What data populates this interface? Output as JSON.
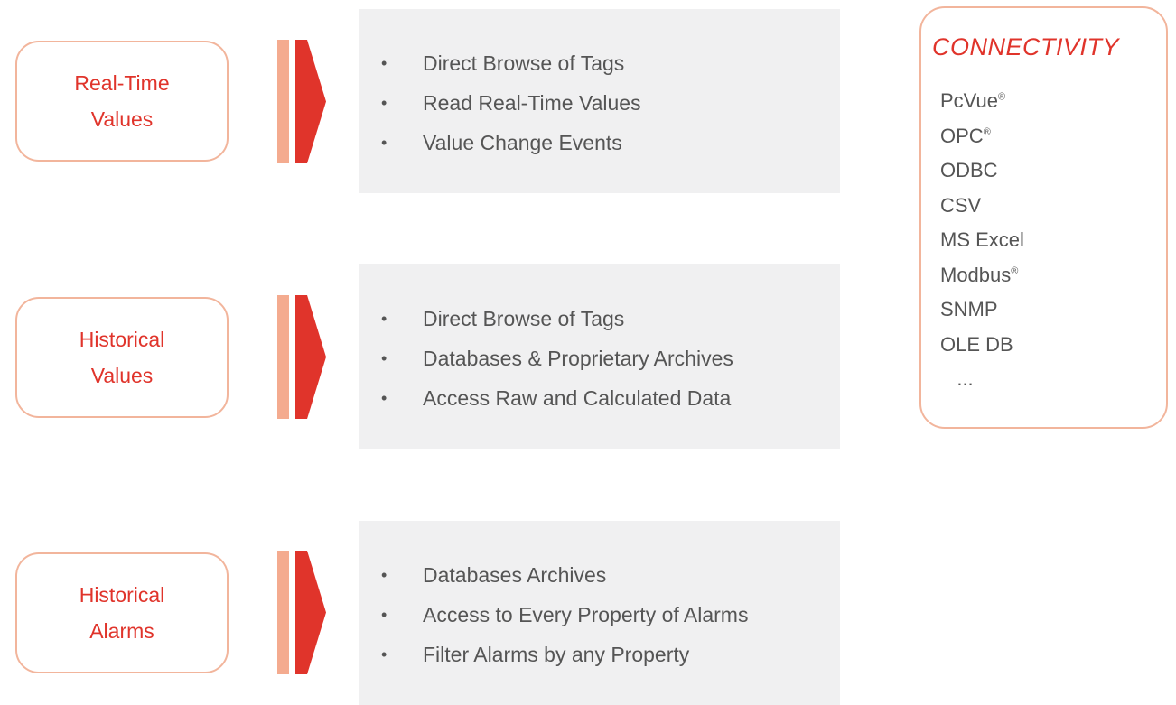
{
  "sections": [
    {
      "category": [
        "Real-Time",
        "Values"
      ],
      "items": [
        "Direct Browse of Tags",
        "Read Real-Time Values",
        "Value Change Events"
      ]
    },
    {
      "category": [
        "Historical",
        "Values"
      ],
      "items": [
        "Direct Browse of Tags",
        "Databases & Proprietary Archives",
        "Access Raw and Calculated Data"
      ]
    },
    {
      "category": [
        "Historical",
        "Alarms"
      ],
      "items": [
        "Databases Archives",
        "Access to Every Property of Alarms",
        "Filter Alarms by any Property"
      ]
    }
  ],
  "bullet_char": "•",
  "connectivity": {
    "title": "CONNECTIVITY",
    "items": [
      {
        "name": "PcVue",
        "mark": "®"
      },
      {
        "name": "OPC",
        "mark": "®"
      },
      {
        "name": "ODBC"
      },
      {
        "name": "CSV"
      },
      {
        "name": "MS Excel"
      },
      {
        "name": "Modbus",
        "mark": "®"
      },
      {
        "name": "SNMP"
      },
      {
        "name": "OLE DB"
      },
      {
        "name": "   ..."
      }
    ]
  },
  "colors": {
    "accent_red": "#e0342b",
    "accent_light": "#f4ab8f",
    "border": "#f2b59c",
    "panel_bg": "#f0f0f1",
    "text_gray": "#555555"
  }
}
